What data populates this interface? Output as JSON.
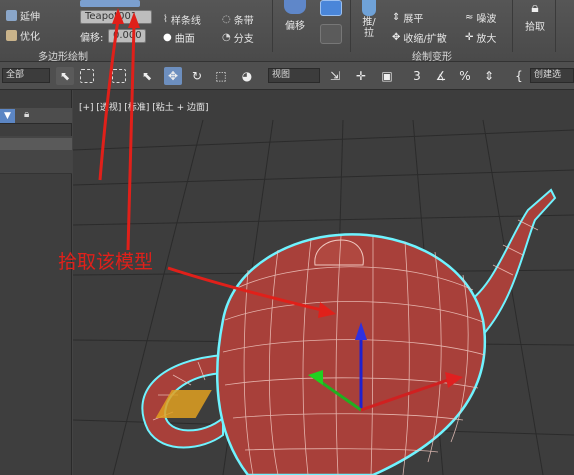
{
  "ribbon": {
    "polygon_tools": {
      "stretch": "延伸",
      "optimize": "优化"
    },
    "object_name": "Teapot001",
    "offset_label": "偏移:",
    "offset_value": "0.000",
    "group_poly_draw": "多边形绘制",
    "spline": "样条线",
    "strip": "条带",
    "surface": "曲面",
    "branch": "分支",
    "offset_big": "偏移",
    "push_pull": "推/\n拉",
    "flatten": "展平",
    "shrink_expand": "收缩/扩散",
    "ripple": "噪波",
    "enlarge": "放大",
    "pick": "拾取",
    "group_paint_deform": "绘制变形"
  },
  "toolbar": {
    "selection_filter": "全部",
    "reference_coord": "视图",
    "create_selection": "创建选"
  },
  "viewport": {
    "label": "[+] [透视] [标准] [粘土 + 边面]"
  },
  "annotation": {
    "text": "拾取该模型",
    "color": "#e0201a"
  },
  "colors": {
    "teapot_fill": "#a8403a",
    "selection_outline": "#6ff3ff",
    "wireframe": "#f0c8c0"
  }
}
